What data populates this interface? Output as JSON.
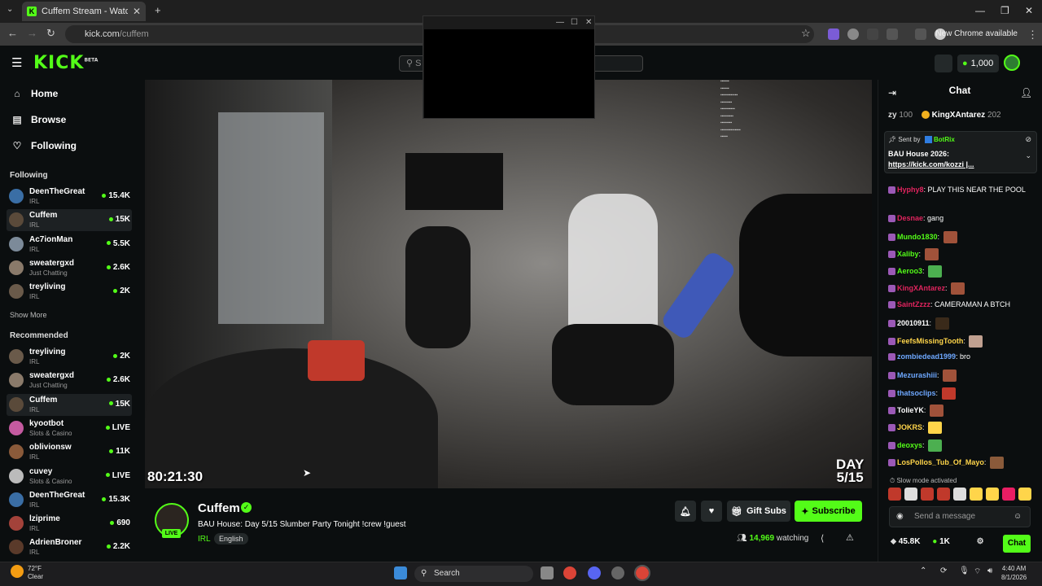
{
  "browser": {
    "tab_title": "Cuffem Stream - Watch Live",
    "url_host": "kick.com",
    "url_path": "/cuffem",
    "new_chrome": "New Chrome available"
  },
  "header": {
    "logo": "KICK",
    "logo_tag": "BETA",
    "search_placeholder": "S",
    "coins": "1,000"
  },
  "sidebar": {
    "nav": [
      {
        "label": "Home",
        "icon": "home-icon"
      },
      {
        "label": "Browse",
        "icon": "browse-icon"
      },
      {
        "label": "Following",
        "icon": "heart-icon"
      }
    ],
    "following_heading": "Following",
    "following": [
      {
        "name": "DeenTheGreat",
        "category": "IRL",
        "viewers": "15.4K",
        "color": "#3a6ea5"
      },
      {
        "name": "Cuffem",
        "category": "IRL",
        "viewers": "15K",
        "color": "#5a4a3a"
      },
      {
        "name": "Ac7ionMan",
        "category": "IRL",
        "viewers": "5.5K",
        "color": "#7c8a99"
      },
      {
        "name": "sweatergxd",
        "category": "Just Chatting",
        "viewers": "2.6K",
        "color": "#8a7a6a"
      },
      {
        "name": "treyliving",
        "category": "IRL",
        "viewers": "2K",
        "color": "#6a5a4a"
      }
    ],
    "show_more": "Show More",
    "recommended_heading": "Recommended",
    "recommended": [
      {
        "name": "treyliving",
        "category": "IRL",
        "viewers": "2K",
        "color": "#6a5a4a"
      },
      {
        "name": "sweatergxd",
        "category": "Just Chatting",
        "viewers": "2.6K",
        "color": "#8a7a6a"
      },
      {
        "name": "Cuffem",
        "category": "IRL",
        "viewers": "15K",
        "color": "#5a4a3a"
      },
      {
        "name": "kyootbot",
        "category": "Slots & Casino",
        "viewers": "LIVE",
        "color": "#c45aa0"
      },
      {
        "name": "oblivionsw",
        "category": "IRL",
        "viewers": "11K",
        "color": "#8a5a3a"
      },
      {
        "name": "cuvey",
        "category": "Slots & Casino",
        "viewers": "LIVE",
        "color": "#bbbbbb"
      },
      {
        "name": "DeenTheGreat",
        "category": "IRL",
        "viewers": "15.3K",
        "color": "#3a6ea5"
      },
      {
        "name": "lziprime",
        "category": "IRL",
        "viewers": "690",
        "color": "#a3423a"
      },
      {
        "name": "AdrienBroner",
        "category": "IRL",
        "viewers": "2.2K",
        "color": "#5a3a2a"
      }
    ]
  },
  "video": {
    "timer": "80:21:30",
    "day_badge_1": "DAY",
    "day_badge_2": "5/15"
  },
  "stream": {
    "name": "Cuffem",
    "live_label": "LIVE",
    "title": "BAU House: Day 5/15 Slumber Party Tonight !crew !guest",
    "category": "IRL",
    "language": "English",
    "gift_subs": "Gift Subs",
    "subscribe": "Subscribe",
    "watching_count": "14,969",
    "watching_label": "watching"
  },
  "chat": {
    "title": "Chat",
    "leader_1_name": "zy",
    "leader_1_count": "100",
    "leader_2_name": "KingXAntarez",
    "leader_2_count": "202",
    "pinned_sent_by": "Sent by",
    "pinned_bot": "BotRix",
    "pinned_text": "BAU House 2026:",
    "pinned_link": "https://kick.com/kozzi |...",
    "messages": [
      {
        "user": "Hyphy8",
        "color": "#e0245e",
        "text": "PLAY THIS NEAR THE POOL",
        "emote": ""
      },
      {
        "user": "Desnae",
        "color": "#e0245e",
        "text": "gang",
        "emote": ""
      },
      {
        "user": "Mundo1830",
        "color": "#53fc18",
        "text": "",
        "emote": "#a0523a"
      },
      {
        "user": "Xaliby",
        "color": "#53fc18",
        "text": "",
        "emote": "#a0523a"
      },
      {
        "user": "Aeroo3",
        "color": "#53fc18",
        "text": "",
        "emote": "#4caf50"
      },
      {
        "user": "KingXAntarez",
        "color": "#e0245e",
        "text": "",
        "emote": "#a0523a"
      },
      {
        "user": "SaintZzzz",
        "color": "#e0245e",
        "text": "CAMERAMAN A BTCH",
        "emote": ""
      },
      {
        "user": "20010911",
        "color": "#ffffff",
        "text": "",
        "emote": "#3a2a1a"
      },
      {
        "user": "FeefsMissingTooth",
        "color": "#ffd54a",
        "text": "",
        "emote": "#c0a090"
      },
      {
        "user": "zombiedead1999",
        "color": "#6ea8ff",
        "text": "bro",
        "emote": ""
      },
      {
        "user": "Mezurashiii",
        "color": "#6ea8ff",
        "text": "",
        "emote": "#a0523a"
      },
      {
        "user": "thatsoclips",
        "color": "#6ea8ff",
        "text": "",
        "emote": "#c0392b"
      },
      {
        "user": "TolieYK",
        "color": "#ffffff",
        "text": "",
        "emote": "#a0523a"
      },
      {
        "user": "JOKRS",
        "color": "#ffd54a",
        "text": "",
        "emote": "#ffd54a"
      },
      {
        "user": "deoxys",
        "color": "#53fc18",
        "text": "",
        "emote": "#4caf50"
      },
      {
        "user": "LosPollos_Tub_Of_Mayo",
        "color": "#ffd54a",
        "text": "",
        "emote": "#8a5a3a"
      }
    ],
    "slow_mode": "Slow mode activated",
    "input_placeholder": "Send a message",
    "footer_count_1": "45.8K",
    "footer_count_2": "1K",
    "chat_button": "Chat"
  },
  "taskbar": {
    "temp": "72°F",
    "condition": "Clear",
    "search": "Search",
    "time": "4:40 AM",
    "date": "8/1/2026"
  },
  "colors": {
    "accent": "#53fc18",
    "background": "#0b0e0f"
  }
}
